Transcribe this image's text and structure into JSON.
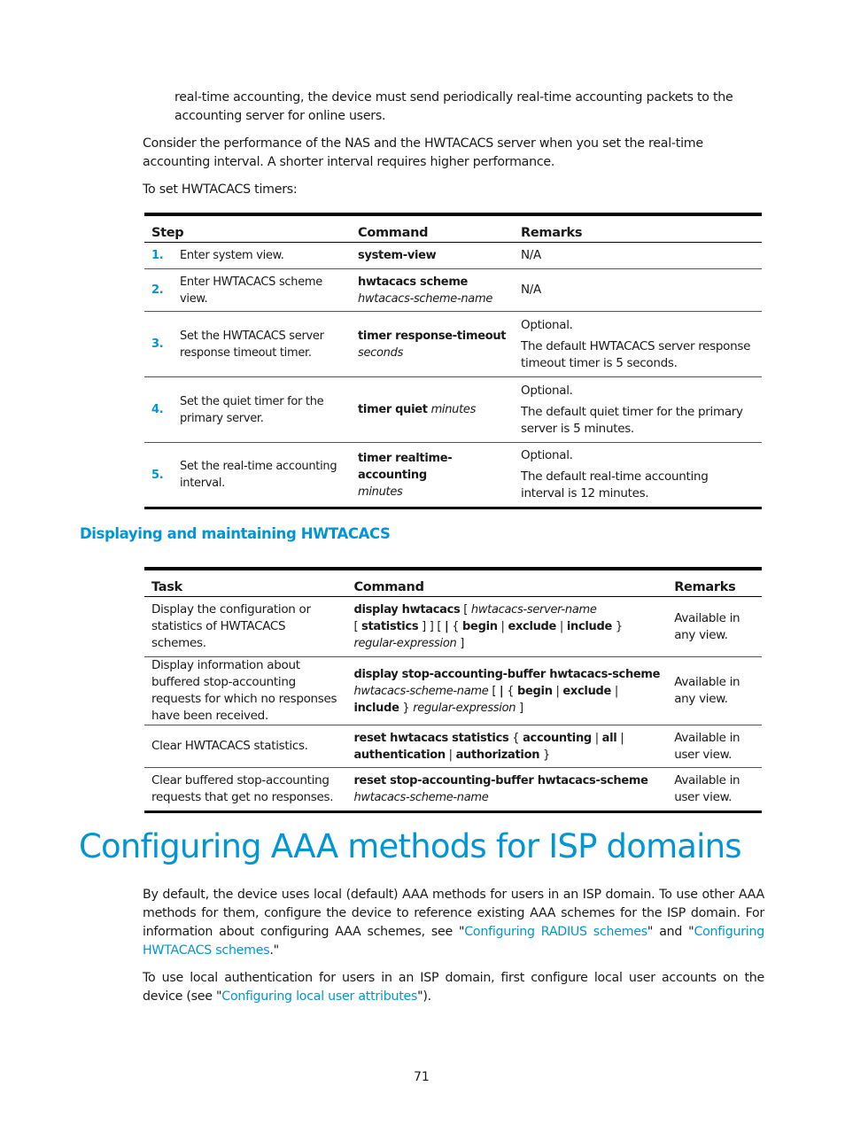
{
  "intro": {
    "continuation": "real-time accounting, the device must send periodically real-time accounting packets to the accounting server for online users.",
    "consider": "Consider the performance of the NAS and the HWTACACS server when you set the real-time accounting interval. A shorter interval requires higher performance.",
    "to_set": "To set HWTACACS timers:"
  },
  "timers_table": {
    "headers": [
      "Step",
      "Command",
      "Remarks"
    ],
    "rows": [
      {
        "num": "1.",
        "step": "Enter system view.",
        "cmd_bold": "system-view",
        "cmd_italic": "",
        "cmd_layout": "inline",
        "remark_optional": "",
        "remark": "N/A"
      },
      {
        "num": "2.",
        "step": "Enter HWTACACS scheme view.",
        "cmd_bold": "hwtacacs scheme",
        "cmd_italic": "hwtacacs-scheme-name",
        "cmd_layout": "block",
        "remark_optional": "",
        "remark": "N/A"
      },
      {
        "num": "3.",
        "step": "Set the HWTACACS server response timeout timer.",
        "cmd_bold": "timer response-timeout",
        "cmd_italic": "seconds",
        "cmd_layout": "block",
        "remark_optional": "Optional.",
        "remark": "The default HWTACACS server response timeout timer is 5 seconds."
      },
      {
        "num": "4.",
        "step": "Set the quiet timer for the primary server.",
        "cmd_bold": "timer quiet",
        "cmd_italic": "minutes",
        "cmd_layout": "inline",
        "remark_optional": "Optional.",
        "remark": "The default quiet timer for the primary server is 5 minutes."
      },
      {
        "num": "5.",
        "step": "Set the real-time accounting interval.",
        "cmd_bold": "timer realtime-accounting",
        "cmd_italic": "minutes",
        "cmd_layout": "block",
        "remark_optional": "Optional.",
        "remark": "The default real-time accounting interval is 12 minutes."
      }
    ]
  },
  "display_section": {
    "heading": "Displaying and maintaining HWTACACS",
    "table": {
      "headers": [
        "Task",
        "Command",
        "Remarks"
      ],
      "rows": [
        {
          "task": "Display the configuration or statistics of HWTACACS schemes.",
          "remark": "Available in any view.",
          "command": [
            {
              "t": "display hwtacacs",
              "s": "b"
            },
            {
              "t": " [ ",
              "s": ""
            },
            {
              "t": "hwtacacs-server-name",
              "s": "i"
            },
            {
              "t": "\n[ ",
              "s": ""
            },
            {
              "t": "statistics",
              "s": "b"
            },
            {
              "t": " ] ] [ ",
              "s": ""
            },
            {
              "t": "|",
              "s": "b"
            },
            {
              "t": " { ",
              "s": ""
            },
            {
              "t": "begin",
              "s": "b"
            },
            {
              "t": " | ",
              "s": ""
            },
            {
              "t": "exclude",
              "s": "b"
            },
            {
              "t": " | ",
              "s": ""
            },
            {
              "t": "include",
              "s": "b"
            },
            {
              "t": " }\n",
              "s": ""
            },
            {
              "t": "regular-expression",
              "s": "i"
            },
            {
              "t": " ]",
              "s": ""
            }
          ]
        },
        {
          "task": "Display information about buffered stop-accounting requests for which no responses have been received.",
          "remark": "Available in any view.",
          "command": [
            {
              "t": "display stop-accounting-buffer hwtacacs-scheme",
              "s": "b"
            },
            {
              "t": "\n",
              "s": ""
            },
            {
              "t": "hwtacacs-scheme-name",
              "s": "i"
            },
            {
              "t": " [ ",
              "s": ""
            },
            {
              "t": "|",
              "s": "b"
            },
            {
              "t": " { ",
              "s": ""
            },
            {
              "t": "begin",
              "s": "b"
            },
            {
              "t": " | ",
              "s": ""
            },
            {
              "t": "exclude",
              "s": "b"
            },
            {
              "t": " |\n",
              "s": ""
            },
            {
              "t": "include",
              "s": "b"
            },
            {
              "t": " } ",
              "s": ""
            },
            {
              "t": "regular-expression",
              "s": "i"
            },
            {
              "t": " ]",
              "s": ""
            }
          ]
        },
        {
          "task": "Clear HWTACACS statistics.",
          "remark": "Available in user view.",
          "command": [
            {
              "t": "reset hwtacacs statistics",
              "s": "b"
            },
            {
              "t": " { ",
              "s": ""
            },
            {
              "t": "accounting",
              "s": "b"
            },
            {
              "t": " | ",
              "s": ""
            },
            {
              "t": "all",
              "s": "b"
            },
            {
              "t": " |\n",
              "s": ""
            },
            {
              "t": "authentication",
              "s": "b"
            },
            {
              "t": " | ",
              "s": ""
            },
            {
              "t": "authorization",
              "s": "b"
            },
            {
              "t": " }",
              "s": ""
            }
          ]
        },
        {
          "task": "Clear buffered stop-accounting requests that get no responses.",
          "remark": "Available in user view.",
          "command": [
            {
              "t": "reset stop-accounting-buffer hwtacacs-scheme",
              "s": "b"
            },
            {
              "t": "\n",
              "s": ""
            },
            {
              "t": "hwtacacs-scheme-name",
              "s": "i"
            }
          ]
        }
      ]
    }
  },
  "aaa_section": {
    "heading": "Configuring AAA methods for ISP domains",
    "para1": [
      {
        "t": "By default, the device uses local (default) AAA methods for users in an ISP domain. To use other AAA methods for them, configure the device to reference existing AAA schemes for the ISP domain. For information about configuring AAA schemes, see \"",
        "link": false
      },
      {
        "t": "Configuring RADIUS schemes",
        "link": true
      },
      {
        "t": "\" and \"",
        "link": false
      },
      {
        "t": "Configuring HWTACACS schemes",
        "link": true
      },
      {
        "t": ".\"",
        "link": false
      }
    ],
    "para2": [
      {
        "t": "To use local authentication for users in an ISP domain, first configure local user accounts on the device (see \"",
        "link": false
      },
      {
        "t": "Configuring local user attributes",
        "link": true
      },
      {
        "t": "\").",
        "link": false
      }
    ]
  },
  "footer": {
    "page_number": "71"
  },
  "colors": {
    "accent": "#0096d6",
    "text": "#1a1a1a",
    "rule": "#000000"
  }
}
